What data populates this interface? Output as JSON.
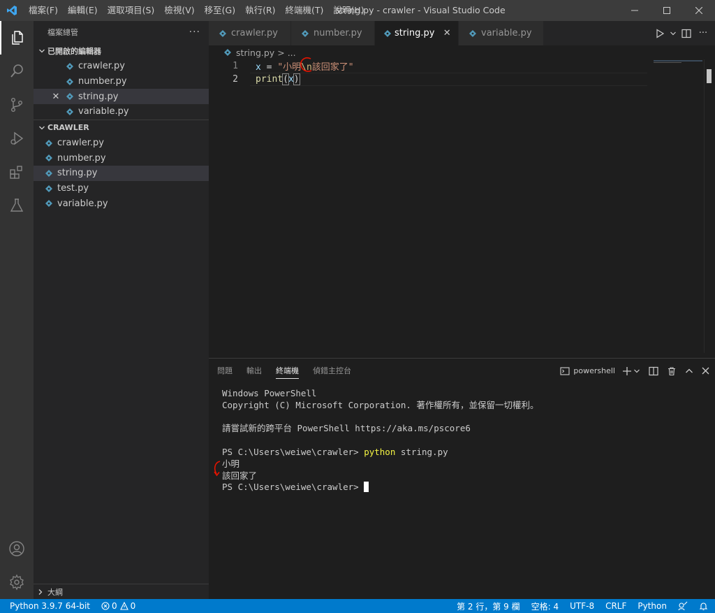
{
  "titlebar": {
    "menu": [
      "檔案(F)",
      "編輯(E)",
      "選取項目(S)",
      "檢視(V)",
      "移至(G)",
      "執行(R)",
      "終端機(T)",
      "說明(H)"
    ],
    "title": "string.py - crawler - Visual Studio Code"
  },
  "sidebar": {
    "header": "檔案總管",
    "open_editors": {
      "title": "已開啟的編輯器",
      "items": [
        "crawler.py",
        "number.py",
        "string.py",
        "variable.py"
      ]
    },
    "folder": {
      "title": "CRAWLER",
      "items": [
        "crawler.py",
        "number.py",
        "string.py",
        "test.py",
        "variable.py"
      ]
    },
    "outline": "大綱"
  },
  "tabs": [
    {
      "label": "crawler.py",
      "active": false
    },
    {
      "label": "number.py",
      "active": false
    },
    {
      "label": "string.py",
      "active": true
    },
    {
      "label": "variable.py",
      "active": false
    }
  ],
  "breadcrumb": {
    "file": "string.py",
    "sep": ">",
    "rest": "..."
  },
  "code": {
    "line1": {
      "no": "1",
      "var": "x",
      "op": " = ",
      "str_a": "\"小明",
      "escape": "\\n",
      "str_b": "該回家了\""
    },
    "line2": {
      "no": "2",
      "fn": "print",
      "open": "(",
      "arg": "x",
      "close": ")"
    }
  },
  "panel": {
    "tabs": [
      "問題",
      "輸出",
      "終端機",
      "偵錯主控台"
    ],
    "active_tab": "終端機",
    "shell": "powershell",
    "terminal": {
      "l1": "Windows PowerShell",
      "l2": "Copyright (C) Microsoft Corporation. 著作權所有，並保留一切權利。",
      "l3": "請嘗試新的跨平台 PowerShell https://aka.ms/pscore6",
      "prompt1": "PS C:\\Users\\weiwe\\crawler> ",
      "cmd": "python",
      "cmd_arg": " string.py",
      "out1": "小明",
      "out2": "該回家了",
      "prompt2": "PS C:\\Users\\weiwe\\crawler> "
    }
  },
  "statusbar": {
    "python": "Python 3.9.7 64-bit",
    "errors": "0",
    "warnings": "0",
    "position": "第 2 行，第 9 欄",
    "spaces": "空格: 4",
    "encoding": "UTF-8",
    "eol": "CRLF",
    "language": "Python"
  },
  "colors": {
    "accent": "#007acc",
    "python_icon": "#519aba",
    "keyword_var": "#9cdcfe",
    "string": "#ce9178",
    "escape": "#d7ba7d",
    "function": "#dcdcaa",
    "annotation": "#e51400"
  }
}
